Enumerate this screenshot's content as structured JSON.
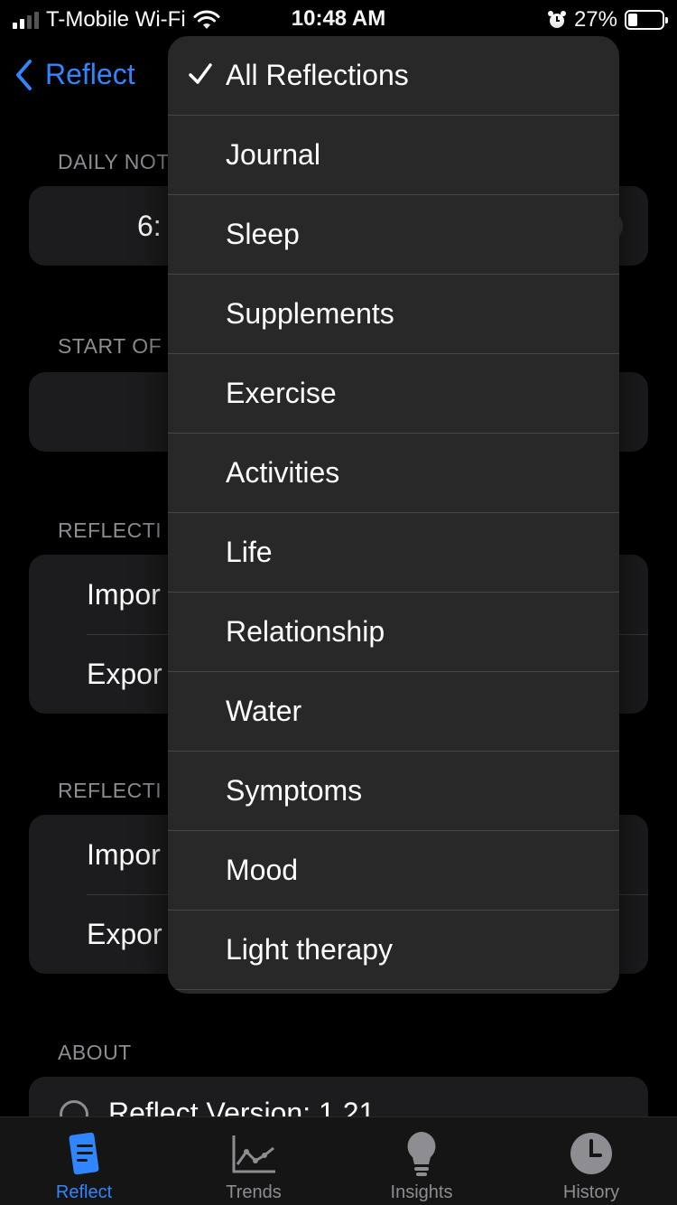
{
  "status_bar": {
    "carrier": "T-Mobile Wi-Fi",
    "time": "10:48 AM",
    "battery_percent": "27%",
    "battery_level": 0.27,
    "icons": [
      "signal-icon",
      "wifi-icon",
      "alarm-icon",
      "battery-icon"
    ]
  },
  "nav": {
    "back_label": "Reflect"
  },
  "settings": {
    "daily_notification_label": "DAILY NOT",
    "daily_notification_value": "6:",
    "start_of_label": "START OF",
    "reflections_label_1": "REFLECTI",
    "import_1": "Impor",
    "export_1": "Expor",
    "reflections_label_2": "REFLECTI",
    "import_2": "Impor",
    "export_2": "Expor",
    "about_label": "ABOUT",
    "version_text": "Reflect Version: 1.21"
  },
  "menu": {
    "items": [
      {
        "label": "All Reflections",
        "selected": true
      },
      {
        "label": "Journal",
        "selected": false
      },
      {
        "label": "Sleep",
        "selected": false
      },
      {
        "label": "Supplements",
        "selected": false
      },
      {
        "label": "Exercise",
        "selected": false
      },
      {
        "label": "Activities",
        "selected": false
      },
      {
        "label": "Life",
        "selected": false
      },
      {
        "label": "Relationship",
        "selected": false
      },
      {
        "label": "Water",
        "selected": false
      },
      {
        "label": "Symptoms",
        "selected": false
      },
      {
        "label": "Mood",
        "selected": false
      },
      {
        "label": "Light therapy",
        "selected": false
      }
    ]
  },
  "tabbar": {
    "tabs": [
      {
        "label": "Reflect",
        "icon": "document-icon",
        "active": true
      },
      {
        "label": "Trends",
        "icon": "line-chart-icon",
        "active": false
      },
      {
        "label": "Insights",
        "icon": "lightbulb-icon",
        "active": false
      },
      {
        "label": "History",
        "icon": "clock-icon",
        "active": false
      }
    ]
  },
  "colors": {
    "accent": "#2f86ff",
    "menu_bg": "#282829",
    "card_bg": "#1c1c1e",
    "secondary_text": "#8d8d92"
  }
}
